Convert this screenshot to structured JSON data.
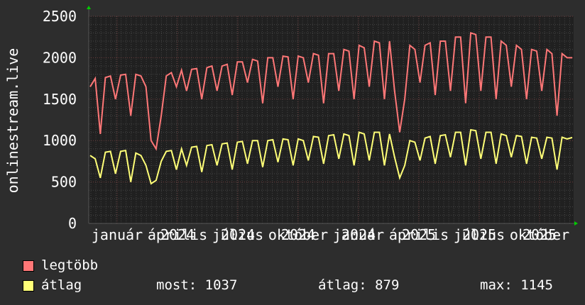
{
  "chart_data": {
    "type": "line",
    "ylabel": "onlinestream.live",
    "ylim": [
      0,
      2500
    ],
    "yticks": [
      "0",
      "500",
      "1000",
      "1500",
      "2000",
      "2500"
    ],
    "grid": true,
    "xtick_months": [
      "január",
      "április",
      "július",
      "október",
      "január",
      "április",
      "július",
      "október"
    ],
    "xtick_years": [
      "2024",
      "2024",
      "2024",
      "2024",
      "2025",
      "2025",
      "2025"
    ],
    "series": [
      {
        "name": "legtöbb",
        "color": "#ff7777",
        "values": [
          1650,
          1750,
          1080,
          1760,
          1780,
          1500,
          1790,
          1800,
          1300,
          1800,
          1780,
          1650,
          1000,
          900,
          1300,
          1780,
          1820,
          1650,
          1850,
          1600,
          1860,
          1870,
          1500,
          1880,
          1900,
          1600,
          1900,
          1920,
          1550,
          1950,
          1950,
          1700,
          1980,
          1960,
          1450,
          2000,
          2000,
          1650,
          2020,
          2010,
          1500,
          2020,
          2000,
          1700,
          2050,
          2030,
          1450,
          2050,
          2050,
          1600,
          2100,
          2080,
          1500,
          2150,
          2120,
          1650,
          2200,
          2180,
          1500,
          2200,
          1600,
          1100,
          1500,
          2150,
          2100,
          1700,
          2150,
          2180,
          1550,
          2200,
          2200,
          1600,
          2250,
          2250,
          1450,
          2300,
          2280,
          1600,
          2250,
          2250,
          1500,
          2200,
          2150,
          1650,
          2150,
          2100,
          1500,
          2100,
          2080,
          1600,
          2100,
          2050,
          1300,
          2050,
          2000,
          2000
        ]
      },
      {
        "name": "átlag",
        "color": "#ffff77",
        "values": [
          820,
          780,
          550,
          860,
          870,
          600,
          870,
          880,
          500,
          850,
          820,
          700,
          480,
          520,
          750,
          870,
          880,
          650,
          900,
          700,
          920,
          930,
          620,
          940,
          950,
          700,
          960,
          970,
          650,
          980,
          990,
          720,
          1000,
          1000,
          680,
          1000,
          1010,
          740,
          1020,
          1010,
          700,
          1020,
          1000,
          760,
          1050,
          1040,
          720,
          1060,
          1070,
          780,
          1080,
          1060,
          700,
          1100,
          1080,
          760,
          1100,
          1100,
          700,
          1080,
          800,
          550,
          700,
          1000,
          980,
          760,
          1030,
          1050,
          720,
          1060,
          1070,
          800,
          1100,
          1100,
          700,
          1130,
          1120,
          780,
          1100,
          1100,
          720,
          1080,
          1060,
          800,
          1060,
          1050,
          720,
          1040,
          1030,
          780,
          1040,
          1030,
          650,
          1040,
          1020,
          1037
        ]
      }
    ]
  },
  "legend": {
    "max_label": "legtöbb",
    "avg_label": "átlag",
    "now": "most: 1037",
    "avg": "átlag: 879",
    "max": "max: 1145"
  }
}
